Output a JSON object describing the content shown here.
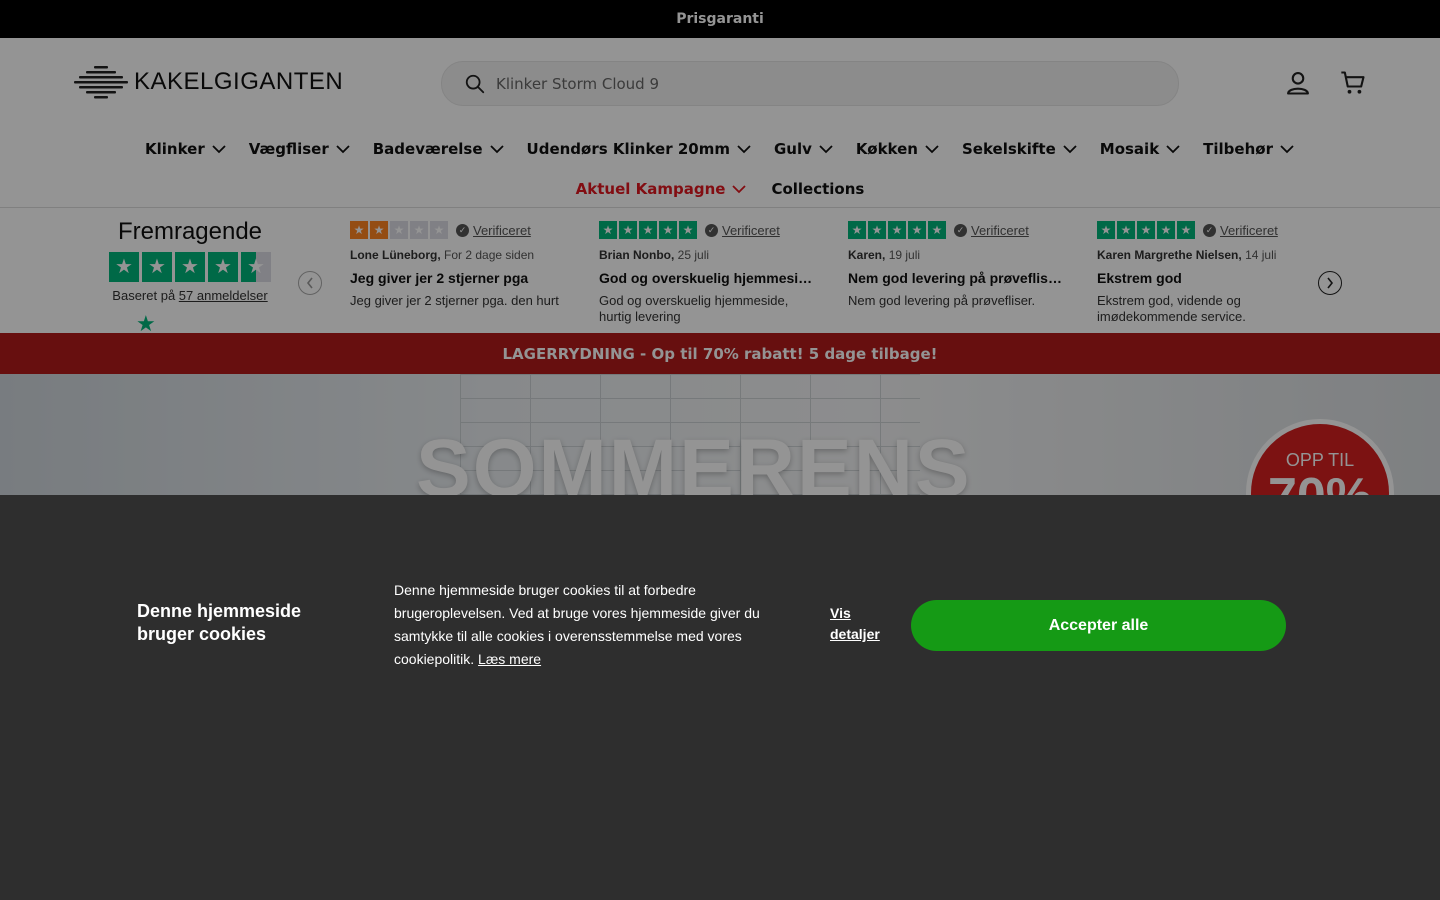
{
  "announcement": "Prisgaranti",
  "header": {
    "logo_text": "KAKELGIGANTEN",
    "search_placeholder": "Klinker Storm Cloud 9"
  },
  "nav": {
    "row1": [
      "Klinker",
      "Vægfliser",
      "Badeværelse",
      "Udendørs Klinker 20mm",
      "Gulv",
      "Køkken",
      "Sekelskifte",
      "Mosaik",
      "Tilbehør"
    ],
    "campaign": "Aktuel Kampagne",
    "collections": "Collections"
  },
  "trustpilot": {
    "title": "Fremragende",
    "based_prefix": "Baseret på",
    "based_link": "57 anmeldelser",
    "rating": 4.5,
    "reviews": [
      {
        "stars": 2,
        "verified": "Verificeret",
        "author": "Lone Lüneborg,",
        "date": "For 2 dage siden",
        "title": "Jeg giver jer 2 stjerner pga",
        "body": "Jeg giver jer 2 stjerner pga. den hurt"
      },
      {
        "stars": 5,
        "verified": "Verificeret",
        "author": "Brian Nonbo,",
        "date": "25 juli",
        "title": "God og overskuelig hjemmeside…",
        "body": "God og overskuelig hjemmeside, hurtig levering"
      },
      {
        "stars": 5,
        "verified": "Verificeret",
        "author": "Karen,",
        "date": "19 juli",
        "title": "Nem god levering på prøvefliser…",
        "body": "Nem god levering på prøvefliser."
      },
      {
        "stars": 5,
        "verified": "Verificeret",
        "author": "Karen Margrethe Nielsen,",
        "date": "14 juli",
        "title": "Ekstrem god",
        "body": "Ekstrem god, vidende og imødekommende service."
      }
    ]
  },
  "promo": "LAGERRYDNING - Op til 70% rabatt! 5 dage tilbage!",
  "hero": {
    "title": "SOMMERENS",
    "badge_small": "OPP TIL",
    "badge_big": "70%"
  },
  "cookie": {
    "title": "Denne hjemmeside bruger cookies",
    "text": "Denne hjemmeside bruger cookies til at forbedre brugeroplevelsen. Ved at bruge vores hjemmeside giver du samtykke til alle cookies i overensstemmelse med vores cookiepolitik.",
    "read_more": "Læs mere",
    "details": "Vis detaljer",
    "accept": "Accepter alle"
  },
  "colors": {
    "promo_bg": "#b21a1a",
    "trustpilot_green": "#00b67a",
    "accept_green": "#159a15",
    "campaign_red": "#e1171f"
  }
}
